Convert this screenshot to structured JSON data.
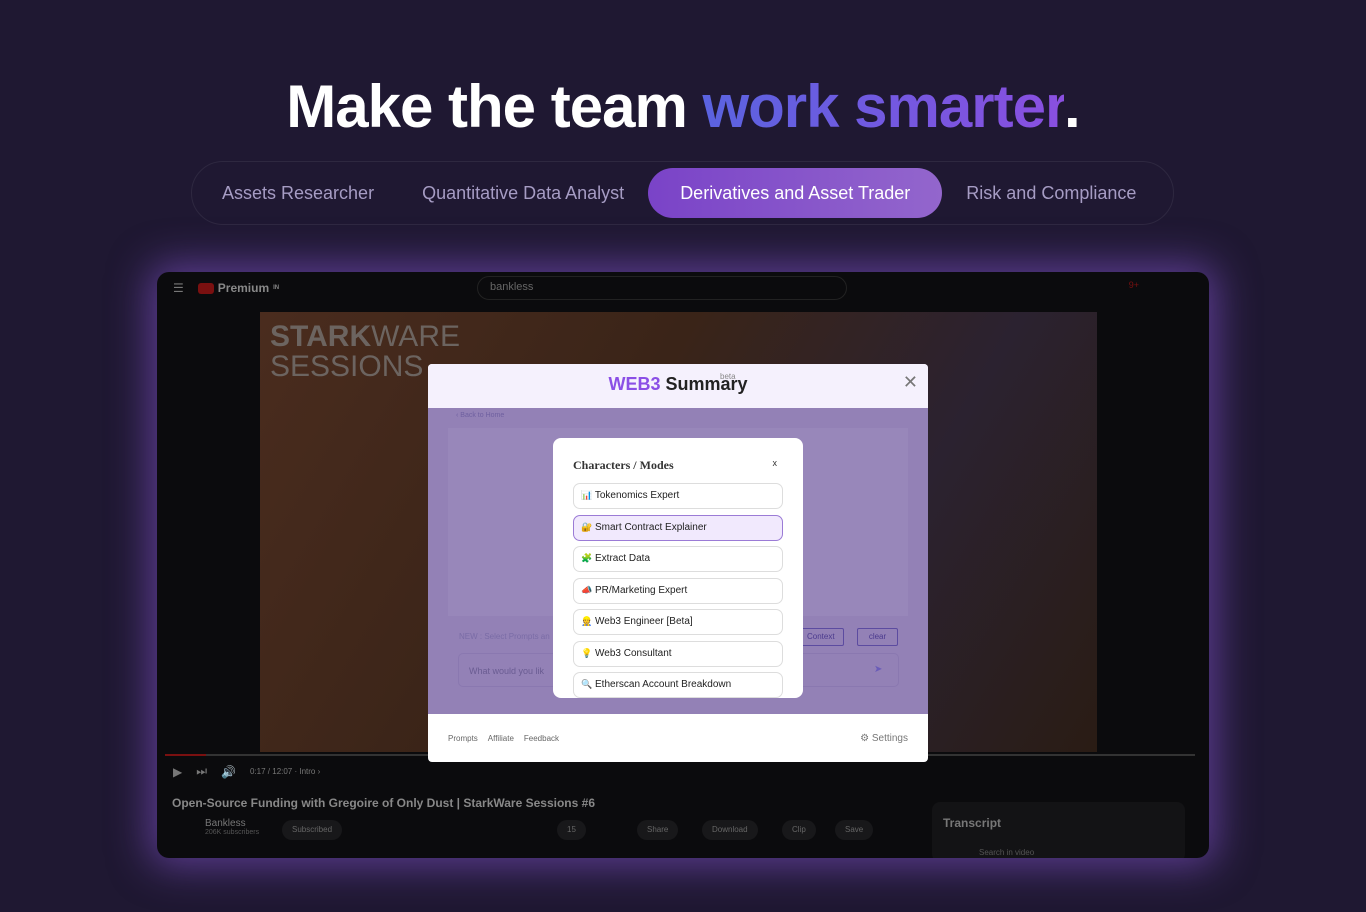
{
  "hero": {
    "title_plain": "Make the team ",
    "title_accent": "work smarter",
    "title_end": "."
  },
  "tabs": [
    {
      "label": "Assets Researcher"
    },
    {
      "label": "Quantitative Data Analyst"
    },
    {
      "label": "Derivatives and Asset Trader",
      "active": true
    },
    {
      "label": "Risk and Compliance"
    }
  ],
  "youtube": {
    "logo": "Premium",
    "region": "IN",
    "search": "bankless",
    "video_brand_1": "STARK",
    "video_brand_2": "WARE",
    "video_brand_3": "SESSIONS",
    "time": "0:17 / 12:07 · Intro ›",
    "title": "Open-Source Funding with Gregoire of Only Dust | StarkWare Sessions #6",
    "channel": "Bankless",
    "subscribers": "206K subscribers",
    "subscribed": "Subscribed",
    "likes": "15",
    "share": "Share",
    "download": "Download",
    "clip": "Clip",
    "save": "Save",
    "transcript": "Transcript",
    "search_video": "Search in video",
    "badge": "9+"
  },
  "extension": {
    "logo_web3": "WEB3",
    "logo_summary": "Summary",
    "beta": "beta",
    "back": "‹ Back to Home",
    "new_text": "NEW : Select Prompts an",
    "context": "Context",
    "clear": "clear",
    "input_placeholder": "What would you lik",
    "footer": {
      "prompts": "Prompts",
      "affiliate": "Affiliate",
      "feedback": "Feedback",
      "settings": "Settings"
    }
  },
  "modes": {
    "title": "Characters / Modes",
    "close": "x",
    "items": [
      {
        "icon": "📊",
        "label": "Tokenomics Expert"
      },
      {
        "icon": "🔐",
        "label": "Smart Contract Explainer",
        "highlighted": true
      },
      {
        "icon": "🧩",
        "label": "Extract Data"
      },
      {
        "icon": "📣",
        "label": "PR/Marketing Expert"
      },
      {
        "icon": "👷",
        "label": "Web3 Engineer [Beta]"
      },
      {
        "icon": "💡",
        "label": "Web3 Consultant"
      },
      {
        "icon": "🔍",
        "label": "Etherscan Account Breakdown"
      }
    ]
  },
  "colors": {
    "background": "#1f1832",
    "accent": "#8b4fe6"
  }
}
